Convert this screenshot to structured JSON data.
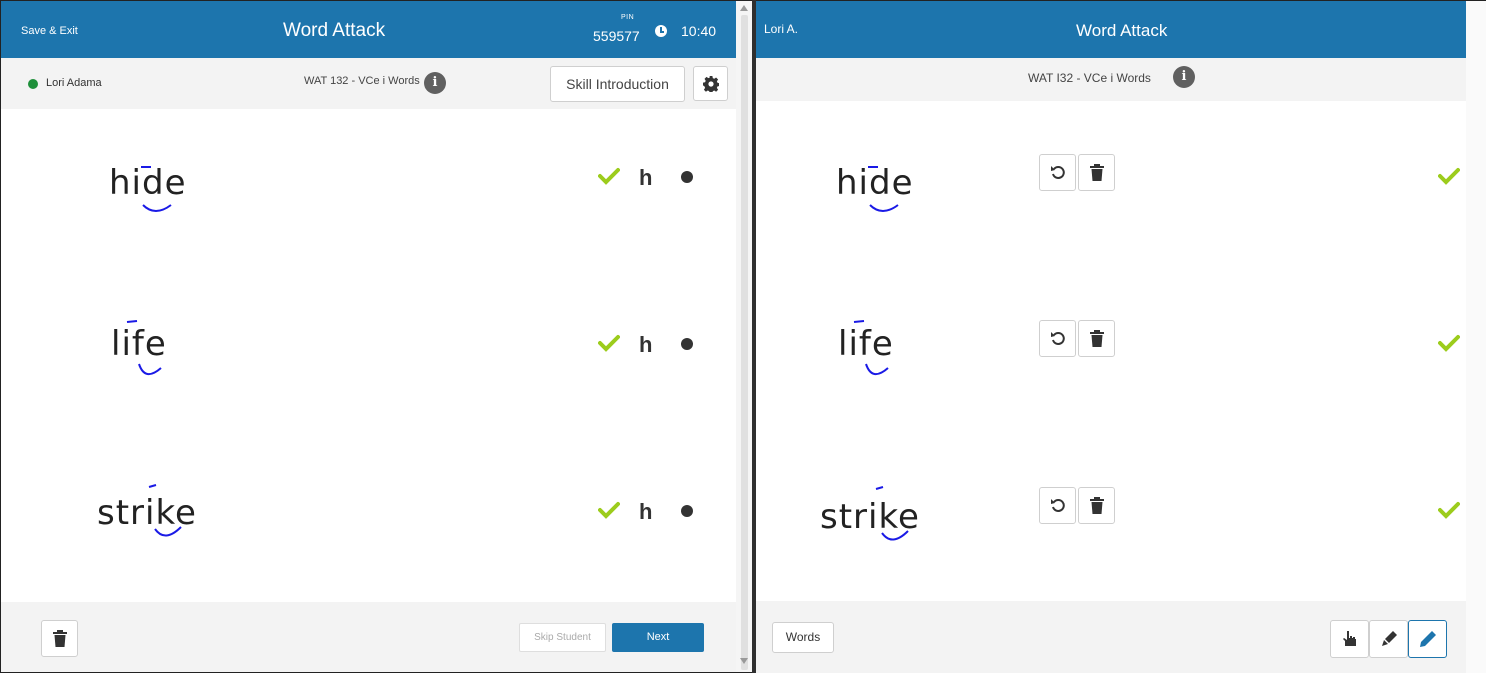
{
  "teacher_view": {
    "save_exit": "Save & Exit",
    "title": "Word Attack",
    "pin_label": "PIN",
    "pin_value": "559577",
    "time": "10:40",
    "student_name": "Lori Adama",
    "status_color": "#1e8f3a",
    "lesson": "WAT 132 - VCe i Words",
    "skill_intro_label": "Skill Introduction",
    "words": [
      {
        "text": "hide",
        "grade_letter": "h"
      },
      {
        "text": "life",
        "grade_letter": "h"
      },
      {
        "text": "strike",
        "grade_letter": "h"
      }
    ],
    "skip_label": "Skip Student",
    "next_label": "Next"
  },
  "student_view": {
    "student_name": "Lori A.",
    "title": "Word Attack",
    "lesson": "WAT I32 - VCe i Words",
    "words": [
      {
        "text": "hide"
      },
      {
        "text": "life"
      },
      {
        "text": "strike"
      }
    ],
    "words_button_label": "Words",
    "tools": [
      "pointer-icon",
      "highlighter-icon",
      "pen-icon"
    ],
    "active_tool": "pen-icon"
  },
  "colors": {
    "header": "#1d75ad",
    "check": "#9ccc1c",
    "annotation": "#1a1ae6"
  }
}
